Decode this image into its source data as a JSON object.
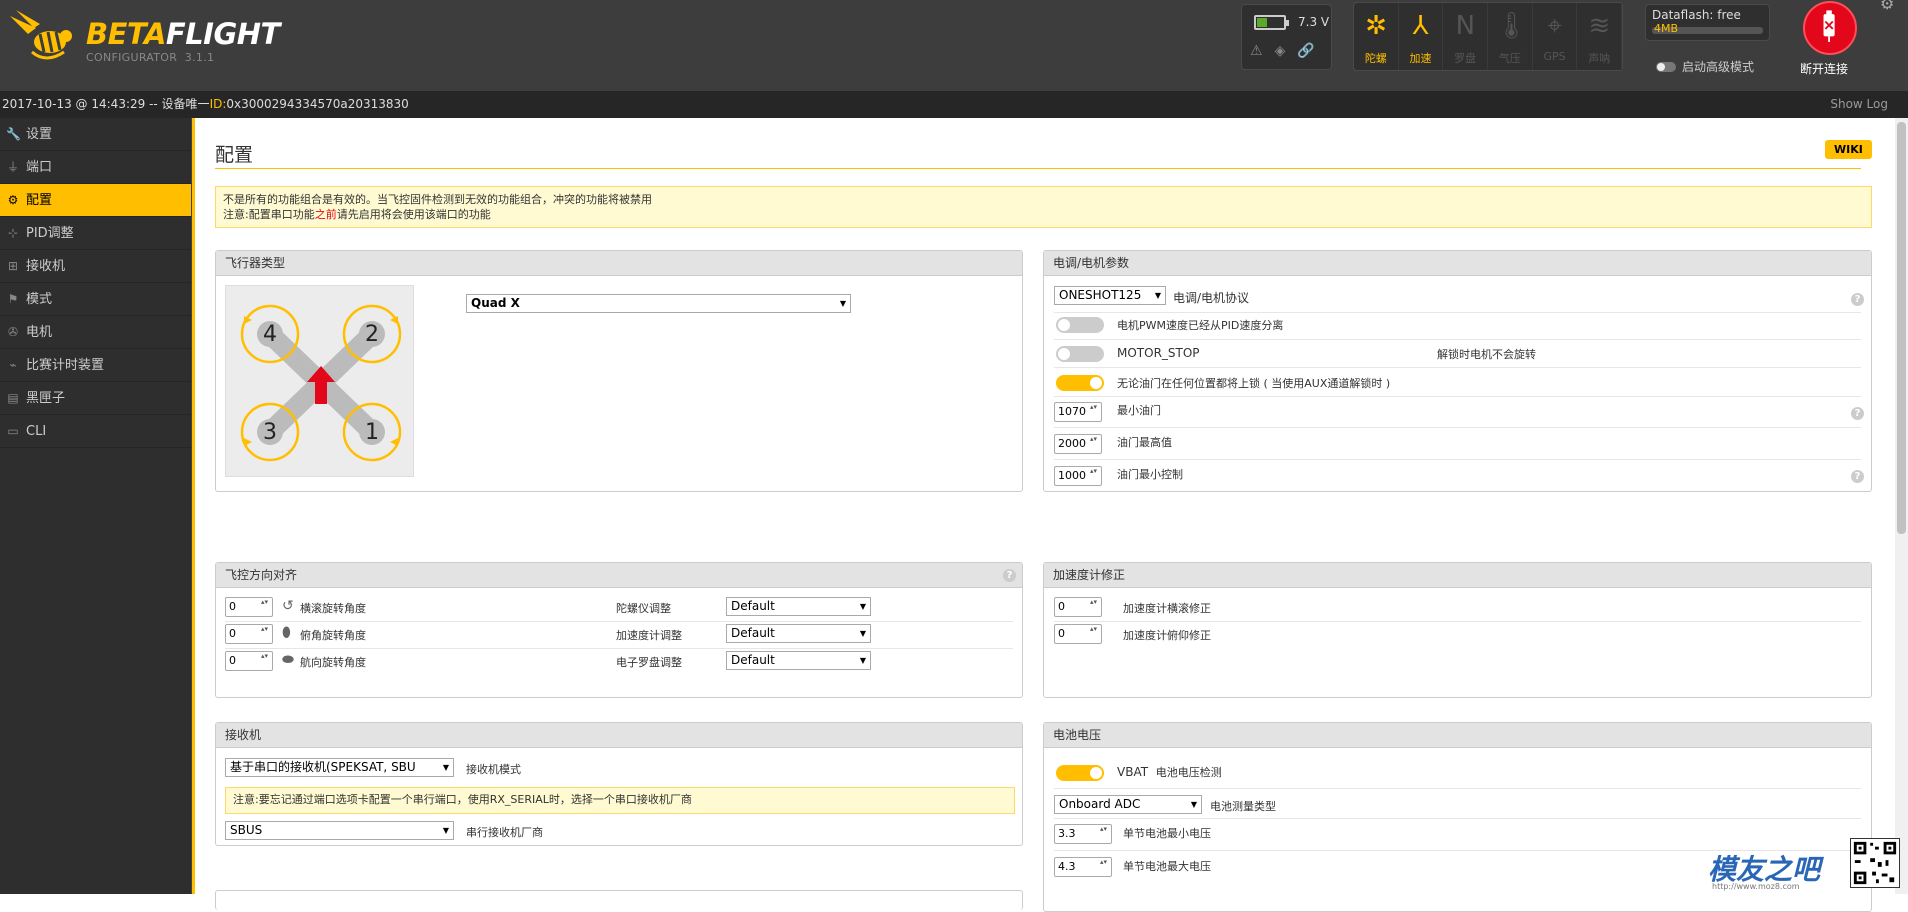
{
  "header": {
    "logo_beta": "BETA",
    "logo_flight": "FLIGHT",
    "configurator": "CONFIGURATOR",
    "version": "3.1.1",
    "battery_voltage": "7.3 V",
    "battery_level": 0.35,
    "sensors": [
      {
        "label": "陀螺",
        "icon": "gyro-icon",
        "state": "on"
      },
      {
        "label": "加速",
        "icon": "accel-icon",
        "state": "on"
      },
      {
        "label": "罗盘",
        "icon": "compass-icon",
        "state": "off"
      },
      {
        "label": "气压",
        "icon": "baro-icon",
        "state": "off"
      },
      {
        "label": "GPS",
        "icon": "gps-icon",
        "state": "off"
      },
      {
        "label": "声呐",
        "icon": "sonar-icon",
        "state": "off"
      }
    ],
    "dataflash_label": "Dataflash: free",
    "dataflash_size": "4MB",
    "expert_mode_label": "启动高级模式",
    "disconnect_label": "断开连接"
  },
  "statusbar": {
    "time": "2017-10-13 @ 14:43:29 -- 设备唯一",
    "id_label": "ID:",
    "id_value": "0x3000294334570a20313830",
    "show_log": "Show Log"
  },
  "sidebar": {
    "items": [
      {
        "label": "设置",
        "icon": "wrench-icon",
        "active": false
      },
      {
        "label": "端口",
        "icon": "plug-icon",
        "active": false
      },
      {
        "label": "配置",
        "icon": "gear-icon",
        "active": true
      },
      {
        "label": "PID调整",
        "icon": "sitemap-icon",
        "active": false
      },
      {
        "label": "接收机",
        "icon": "receiver-icon",
        "active": false
      },
      {
        "label": "模式",
        "icon": "modes-icon",
        "active": false
      },
      {
        "label": "电机",
        "icon": "motor-icon",
        "active": false
      },
      {
        "label": "比赛计时装置",
        "icon": "transponder-icon",
        "active": false
      },
      {
        "label": "黑匣子",
        "icon": "blackbox-icon",
        "active": false
      },
      {
        "label": "CLI",
        "icon": "cli-icon",
        "active": false
      }
    ]
  },
  "page": {
    "title": "配置",
    "wiki": "WIKI",
    "notice_line1": "不是所有的功能组合是有效的。当飞控固件检测到无效的功能组合，冲突的功能将被禁用",
    "notice_line2_a": "注意:配置串口功能",
    "notice_line2_red": "之前",
    "notice_line2_b": "请先启用将会使用该端口的功能"
  },
  "mixer": {
    "title": "飞行器类型",
    "selected": "Quad X",
    "motors": [
      "4",
      "2",
      "3",
      "1"
    ]
  },
  "esc": {
    "title": "电调/电机参数",
    "protocol": "ONESHOT125",
    "protocol_label": "电调/电机协议",
    "pwm_label": "电机PWM速度已经从PID速度分离",
    "motor_stop": "MOTOR_STOP",
    "motor_stop_desc": "解锁时电机不会旋转",
    "arm_label": "无论油门在任何位置都将上锁 ( 当使用AUX通道解锁时 )",
    "min_throttle": "1070",
    "min_throttle_label": "最小油门",
    "max_throttle": "2000",
    "max_throttle_label": "油门最高值",
    "min_command": "1000",
    "min_command_label": "油门最小控制"
  },
  "alignment": {
    "title": "飞控方向对齐",
    "rows": [
      {
        "value": "0",
        "label": "横滚旋转角度",
        "sensor": "陀螺仪调整",
        "select": "Default"
      },
      {
        "value": "0",
        "label": "俯角旋转角度",
        "sensor": "加速度计调整",
        "select": "Default"
      },
      {
        "value": "0",
        "label": "航向旋转角度",
        "sensor": "电子罗盘调整",
        "select": "Default"
      }
    ]
  },
  "accel": {
    "title": "加速度计修正",
    "rows": [
      {
        "value": "0",
        "label": "加速度计横滚修正"
      },
      {
        "value": "0",
        "label": "加速度计俯仰修正"
      }
    ]
  },
  "receiver": {
    "title": "接收机",
    "mode": "基于串口的接收机(SPEKSAT, SBU",
    "mode_label": "接收机模式",
    "note": "注意:要忘记通过端口选项卡配置一个串行端口，使用RX_SERIAL时，选择一个串口接收机厂商",
    "provider": "SBUS",
    "provider_label": "串行接收机厂商"
  },
  "battery": {
    "title": "电池电压",
    "vbat": "VBAT",
    "vbat_label": "电池电压检测",
    "meter": "Onboard ADC",
    "meter_label": "电池测量类型",
    "min_cell": "3.3",
    "min_cell_label": "单节电池最小电压",
    "max_cell": "4.3",
    "max_cell_label": "单节电池最大电压"
  },
  "watermark": {
    "text": "模友之吧",
    "url": "http://www.moz8.com"
  },
  "colors": {
    "accent": "#ffbe00",
    "dark": "#3d3d3d",
    "red": "#e2071a"
  }
}
